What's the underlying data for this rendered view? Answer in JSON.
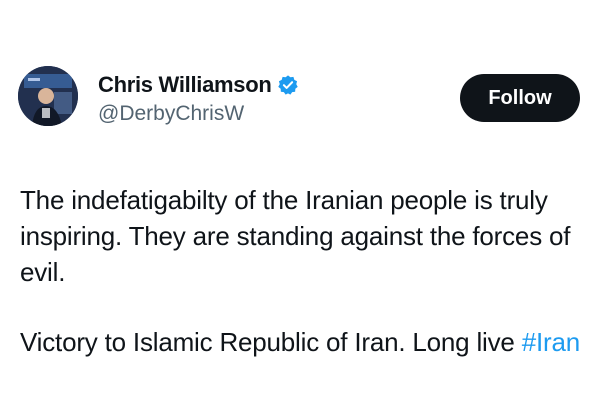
{
  "author": {
    "display_name": "Chris Williamson",
    "handle": "@DerbyChrisW",
    "verified": true,
    "avatar_icon": "profile-photo"
  },
  "follow_button": {
    "label": "Follow"
  },
  "tweet": {
    "paragraph_1": "The indefatigabilty of the Iranian people is truly inspiring. They are standing against the forces of evil.",
    "paragraph_2_text": "Victory to Islamic Republic of Iran. Long live ",
    "hashtag": "#Iran"
  },
  "colors": {
    "text": "#0f1419",
    "secondary_text": "#536471",
    "accent": "#1d9bf0",
    "button_bg": "#0f1419",
    "button_text": "#ffffff"
  }
}
